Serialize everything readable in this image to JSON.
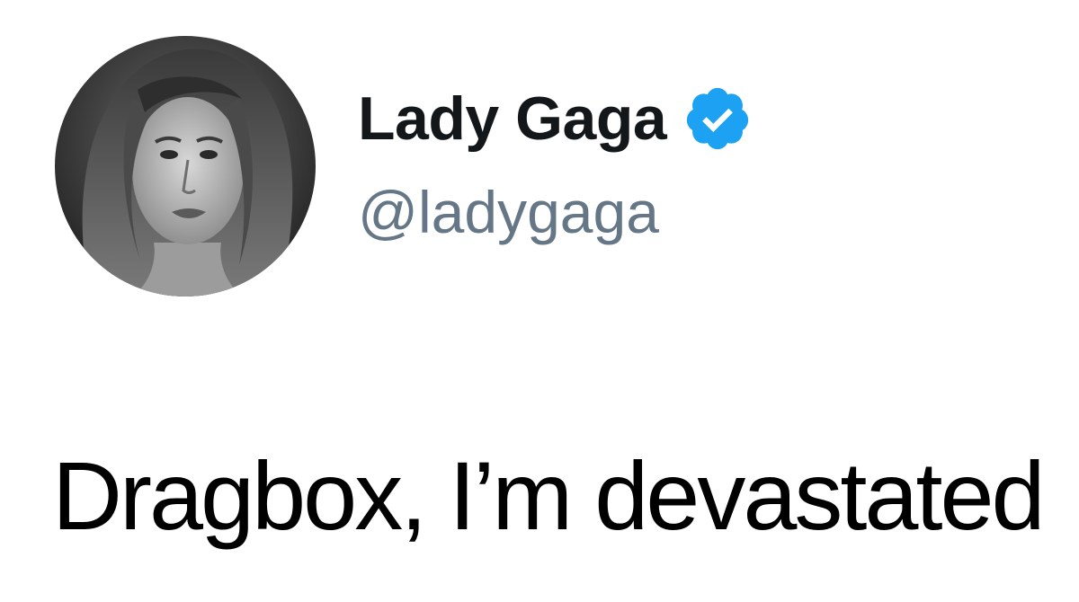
{
  "profile": {
    "display_name": "Lady Gaga",
    "handle": "@ladygaga",
    "verified": true,
    "verified_badge_icon": "verified-badge-icon",
    "verified_badge_color": "#1da1f2"
  },
  "tweet": {
    "text": "Dragbox, I’m devastated"
  },
  "colors": {
    "background": "#ffffff",
    "display_name": "#14171a",
    "handle": "#657786",
    "text": "#000000"
  }
}
